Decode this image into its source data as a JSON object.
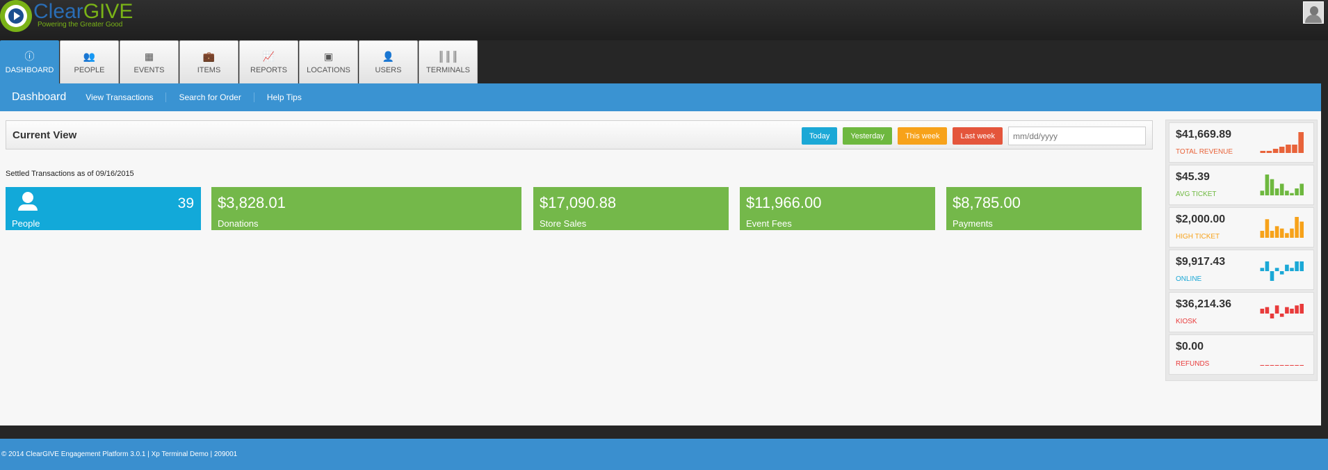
{
  "brand": {
    "name_part1": "Clear",
    "name_part2": "GIVE",
    "tagline": "Powering the Greater Good"
  },
  "tabs": [
    {
      "label": "DASHBOARD",
      "icon": "info-icon",
      "glyph": "ⓘ",
      "active": true
    },
    {
      "label": "PEOPLE",
      "icon": "people-icon",
      "glyph": "👥",
      "active": false
    },
    {
      "label": "EVENTS",
      "icon": "calendar-icon",
      "glyph": "▦",
      "active": false
    },
    {
      "label": "ITEMS",
      "icon": "briefcase-icon",
      "glyph": "💼",
      "active": false
    },
    {
      "label": "REPORTS",
      "icon": "presentation-icon",
      "glyph": "📈",
      "active": false
    },
    {
      "label": "LOCATIONS",
      "icon": "picture-icon",
      "glyph": "▣",
      "active": false
    },
    {
      "label": "USERS",
      "icon": "user-group-icon",
      "glyph": "👤",
      "active": false
    },
    {
      "label": "TERMINALS",
      "icon": "barcode-icon",
      "glyph": "║║║",
      "active": false
    }
  ],
  "subnav": {
    "title": "Dashboard",
    "links": [
      "View Transactions",
      "Search for Order",
      "Help Tips"
    ]
  },
  "current_view": {
    "title": "Current View",
    "buttons": {
      "today": "Today",
      "yesterday": "Yesterday",
      "this_week": "This week",
      "last_week": "Last week"
    },
    "date_placeholder": "mm/dd/yyyy"
  },
  "settled_text": "Settled Transactions as of 09/16/2015",
  "tiles": {
    "people": {
      "count": "39",
      "label": "People"
    },
    "donations": {
      "value": "$3,828.01",
      "label": "Donations"
    },
    "store_sales": {
      "value": "$17,090.88",
      "label": "Store Sales"
    },
    "event_fees": {
      "value": "$11,966.00",
      "label": "Event Fees"
    },
    "payments": {
      "value": "$8,785.00",
      "label": "Payments"
    }
  },
  "stats": [
    {
      "value": "$41,669.89",
      "label": "TOTAL REVENUE",
      "color": "#e8633a",
      "spark": [
        1,
        1,
        2,
        3,
        4,
        4,
        10
      ],
      "negatives": false
    },
    {
      "value": "$45.39",
      "label": "AVG TICKET",
      "color": "#6eb83f",
      "spark": [
        2,
        9,
        7,
        3,
        5,
        2,
        1,
        3,
        5
      ],
      "negatives": false
    },
    {
      "value": "$2,000.00",
      "label": "HIGH TICKET",
      "color": "#f7a21a",
      "spark": [
        3,
        8,
        3,
        5,
        4,
        2,
        4,
        9,
        7
      ],
      "negatives": false
    },
    {
      "value": "$9,917.43",
      "label": "ONLINE",
      "color": "#1ba8d6",
      "spark": [
        1,
        3,
        -3,
        1,
        -1,
        2,
        1,
        3,
        3
      ],
      "negatives": true
    },
    {
      "value": "$36,214.36",
      "label": "KIOSK",
      "color": "#e83b3b",
      "spark": [
        3,
        4,
        -3,
        5,
        -2,
        4,
        3,
        5,
        6
      ],
      "negatives": true
    },
    {
      "value": "$0.00",
      "label": "REFUNDS",
      "color": "#e83b3b",
      "spark": [
        0,
        0,
        0,
        0,
        0,
        0,
        0,
        0,
        0
      ],
      "negatives": false
    }
  ],
  "footer": "© 2014 ClearGIVE Engagement Platform 3.0.1 | Xp Terminal Demo | 209001"
}
